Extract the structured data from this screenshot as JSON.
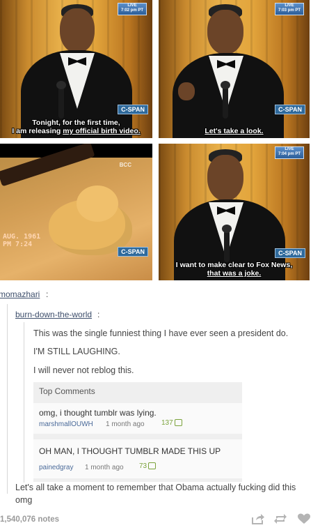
{
  "panels": [
    {
      "live": "LIVE\n7:02 pm PT",
      "network": "C-SPAN",
      "caption_pre": "Tonight, for the first time,\nI am releasing ",
      "caption_link": "my official birth video."
    },
    {
      "live": "LIVE\n7:03 pm PT",
      "network": "C-SPAN",
      "caption_pre": "",
      "caption_link": "Let's take a look."
    },
    {
      "date": "AUG. 1961\nPM 7:24",
      "logo": "BCC",
      "network": "C-SPAN"
    },
    {
      "live": "LIVE\n7:04 pm PT",
      "network": "C-SPAN",
      "caption_pre": "I want to make clear to Fox News,\n",
      "caption_link": "that was a joke."
    }
  ],
  "post": {
    "author": "momazhari",
    "reblogger": "burn-down-the-world",
    "lines": [
      "This was the single funniest thing I have ever seen a president do.",
      "I'M STILL LAUGHING.",
      "I will never not reblog this."
    ],
    "final_comment": "Let's all take a moment to remember that Obama actually fucking did this omg",
    "notes": "1,540,076 notes"
  },
  "top_comments": {
    "heading": "Top Comments",
    "items": [
      {
        "text": "omg, i thought tumblr was lying.",
        "user": "marshmallOUWH",
        "time": "1 month ago",
        "votes": "137"
      },
      {
        "text": "OH MAN, I THOUGHT TUMBLR MADE THIS UP",
        "user": "painedgray",
        "time": "1 month ago",
        "votes": "73"
      }
    ]
  },
  "actions": [
    "share-icon",
    "reblog-icon",
    "like-icon"
  ]
}
